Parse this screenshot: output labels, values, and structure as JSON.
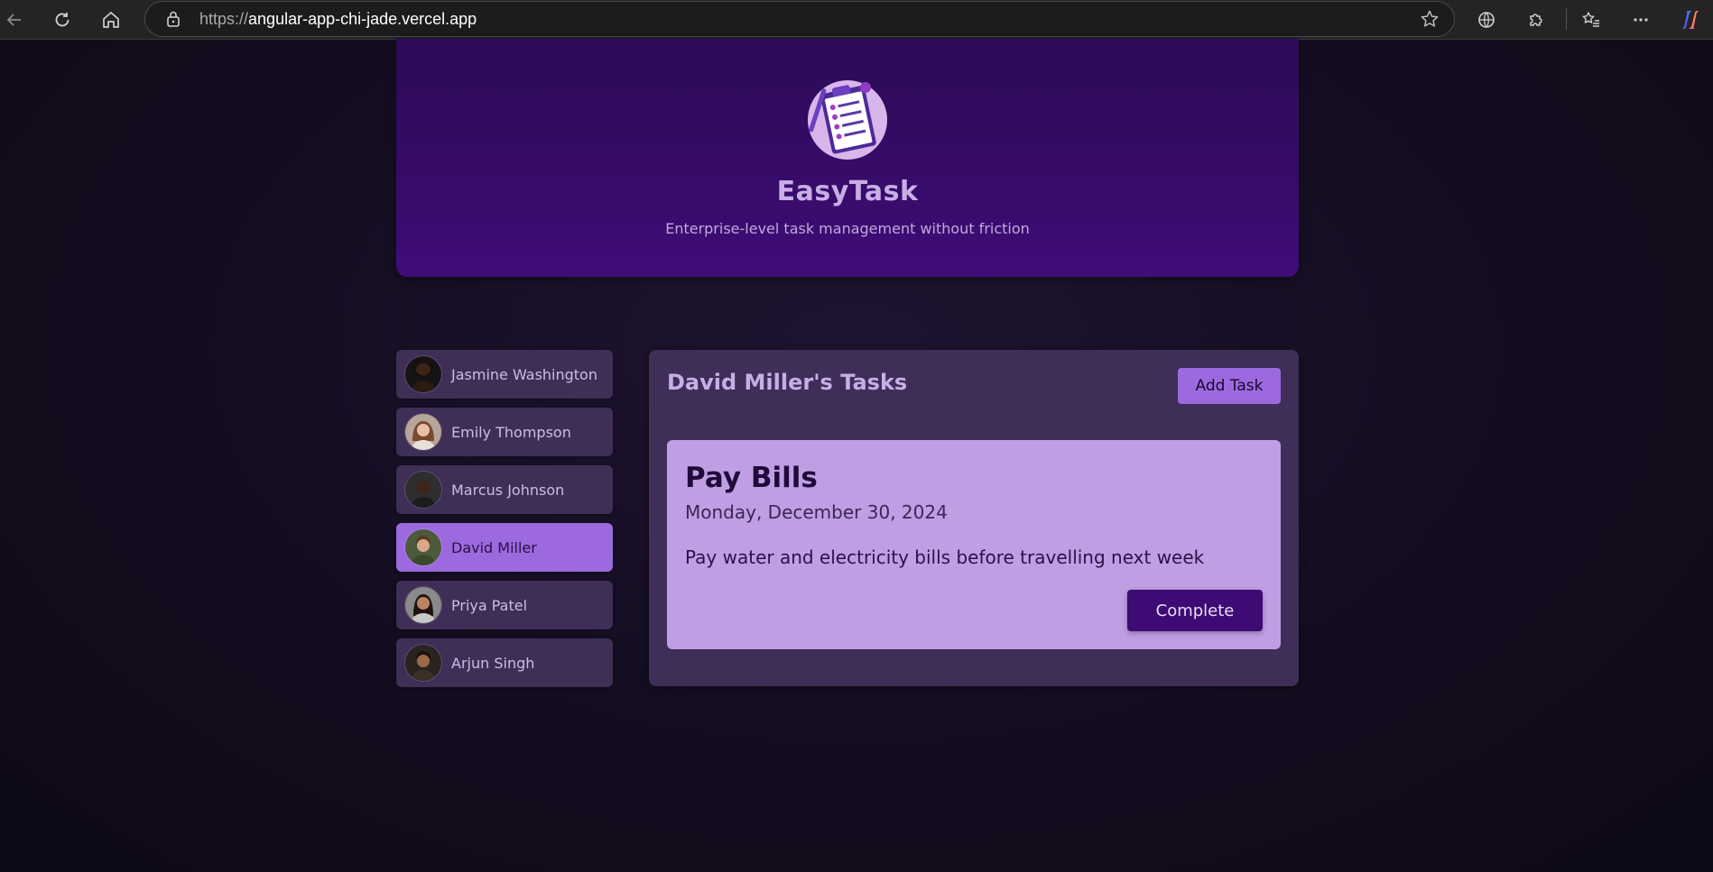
{
  "browser": {
    "url_scheme": "https://",
    "url_host": "angular-app-chi-jade.vercel.app"
  },
  "header": {
    "title": "EasyTask",
    "tagline": "Enterprise-level task management without friction"
  },
  "users": [
    {
      "name": "Jasmine Washington",
      "selected": false
    },
    {
      "name": "Emily Thompson",
      "selected": false
    },
    {
      "name": "Marcus Johnson",
      "selected": false
    },
    {
      "name": "David Miller",
      "selected": true
    },
    {
      "name": "Priya Patel",
      "selected": false
    },
    {
      "name": "Arjun Singh",
      "selected": false
    }
  ],
  "tasks": {
    "heading": "David Miller's Tasks",
    "add_label": "Add Task",
    "items": [
      {
        "title": "Pay Bills",
        "date": "Monday, December 30, 2024",
        "summary": "Pay water and electricity bills before travelling next week",
        "complete_label": "Complete"
      }
    ]
  },
  "colors": {
    "accent": "#9c6ade",
    "header_bg": "#3f0d78",
    "task_card": "#bf9ee3",
    "complete_button": "#3d0b73"
  }
}
